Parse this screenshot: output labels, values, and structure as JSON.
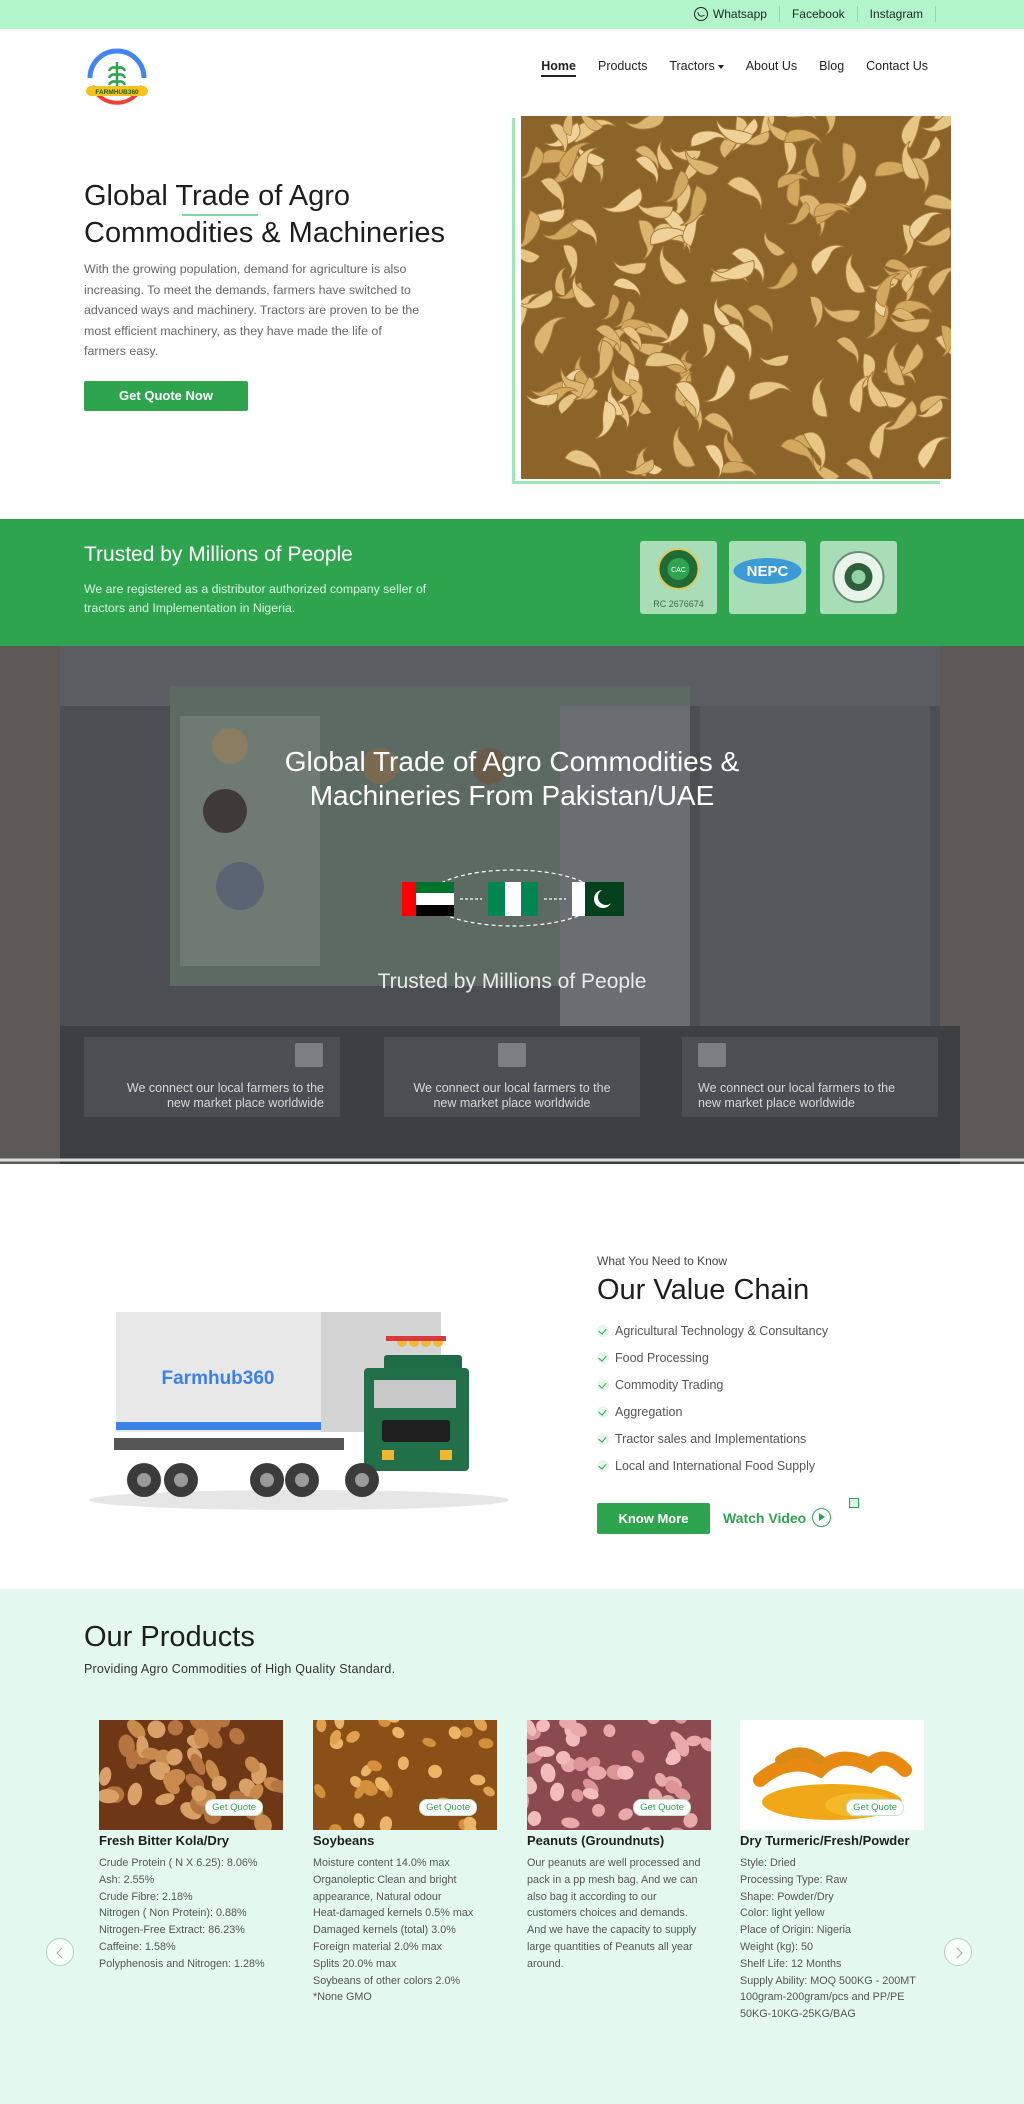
{
  "topbar": {
    "links": [
      {
        "label": "Whatsapp",
        "icon": "whatsapp-icon"
      },
      {
        "label": "Facebook"
      },
      {
        "label": "Instagram"
      }
    ]
  },
  "header": {
    "logo_text": "FARMHUB360",
    "nav": [
      "Home",
      "Products",
      "Tractors",
      "About Us",
      "Blog",
      "Contact Us"
    ]
  },
  "hero": {
    "title_line1": "Global Trade of Agro",
    "title_line2": "Commodities & Machineries",
    "text": "With the growing population, demand for agriculture is also increasing. To meet the demands, farmers have switched to advanced ways and machinery. Tractors are proven to be the most efficient machinery, as they have made the life of farmers easy.",
    "button": "Get Quote Now",
    "slider_count": 12,
    "slider_active": 5
  },
  "trusted": {
    "title": "Trusted by Millions of People",
    "text": "We are registered as a distributor authorized company seller of tractors and Implementation in Nigeria.",
    "badges": [
      {
        "name": "cac-badge",
        "caption": "RC 2676674"
      },
      {
        "name": "nepc-badge",
        "caption": "",
        "text": "NEPC"
      },
      {
        "name": "fmard-badge",
        "caption": ""
      }
    ]
  },
  "booth": {
    "title_line1": "Global Trade of Agro Commodities &",
    "title_line2": "Machineries From Pakistan/UAE",
    "subtitle": "Trusted by Millions of People",
    "features": [
      {
        "icon": "network-icon",
        "line1": "We connect our local farmers to the",
        "line2": "new market place worldwide"
      },
      {
        "icon": "thumbs-up-icon",
        "line1": "We connect our local farmers to the",
        "line2": "new market place worldwide"
      },
      {
        "icon": "chart-icon",
        "line1": "We connect our local farmers to the",
        "line2": "new market place worldwide"
      }
    ]
  },
  "value_chain": {
    "kicker": "What You Need to Know",
    "title": "Our Value Chain",
    "truck_text": "Farmhub360",
    "items": [
      "Agricultural Technology & Consultancy",
      "Food Processing",
      "Commodity Trading",
      "Aggregation",
      "Tractor sales and Implementations",
      "Local and International Food Supply"
    ],
    "button": "Know More",
    "video_link": "Watch Video"
  },
  "products": {
    "title": "Our Products",
    "subtitle": "Providing Agro Commodities of High Quality Standard.",
    "quote_label": "Get Quote",
    "cards": [
      {
        "name": "Fresh Bitter Kola/Dry",
        "lines": [
          "Crude Protein ( N X 6.25): 8.06%",
          "Ash: 2.55%",
          "Crude Fibre: 2.18%",
          "Nitrogen ( Non Protein): 0.88%",
          "Nitrogen-Free Extract: 86.23%",
          "Caffeine: 1.58%",
          "Polyphenosis and Nitrogen: 1.28%"
        ]
      },
      {
        "name": "Soybeans",
        "lines": [
          "Moisture content 14.0% max",
          "Organoleptic Clean and bright",
          "appearance, Natural odour",
          "Heat-damaged kernels 0.5% max",
          "Damaged kernels (total) 3.0%",
          "Foreign material 2.0% max",
          "Splits 20.0% max",
          "Soybeans of other colors 2.0%",
          "*None GMO"
        ]
      },
      {
        "name": "Peanuts (Groundnuts)",
        "lines": [
          "Our peanuts are well processed and",
          "pack in a pp mesh bag. And we can",
          "also bag it according to our",
          "customers choices and demands.",
          "And we have the capacity to supply",
          "large quantities of Peanuts all year",
          "around."
        ]
      },
      {
        "name": "Dry Turmeric/Fresh/Powder",
        "lines": [
          "Style: Dried",
          "Processing Type: Raw",
          "Shape: Powder/Dry",
          "Color: light yellow",
          "Place of Origin: Nigeria",
          "Weight (kg): 50",
          "Shelf Life: 12 Months",
          "Supply Ability: MOQ 500KG - 200MT",
          "100gram-200gram/pcs and PP/PE",
          "50KG-10KG-25KG/BAG"
        ]
      }
    ]
  },
  "colors": {
    "brand_green": "#2ea44f",
    "topbar": "#b3f5cb",
    "products_bg": "#e3f8ef"
  }
}
